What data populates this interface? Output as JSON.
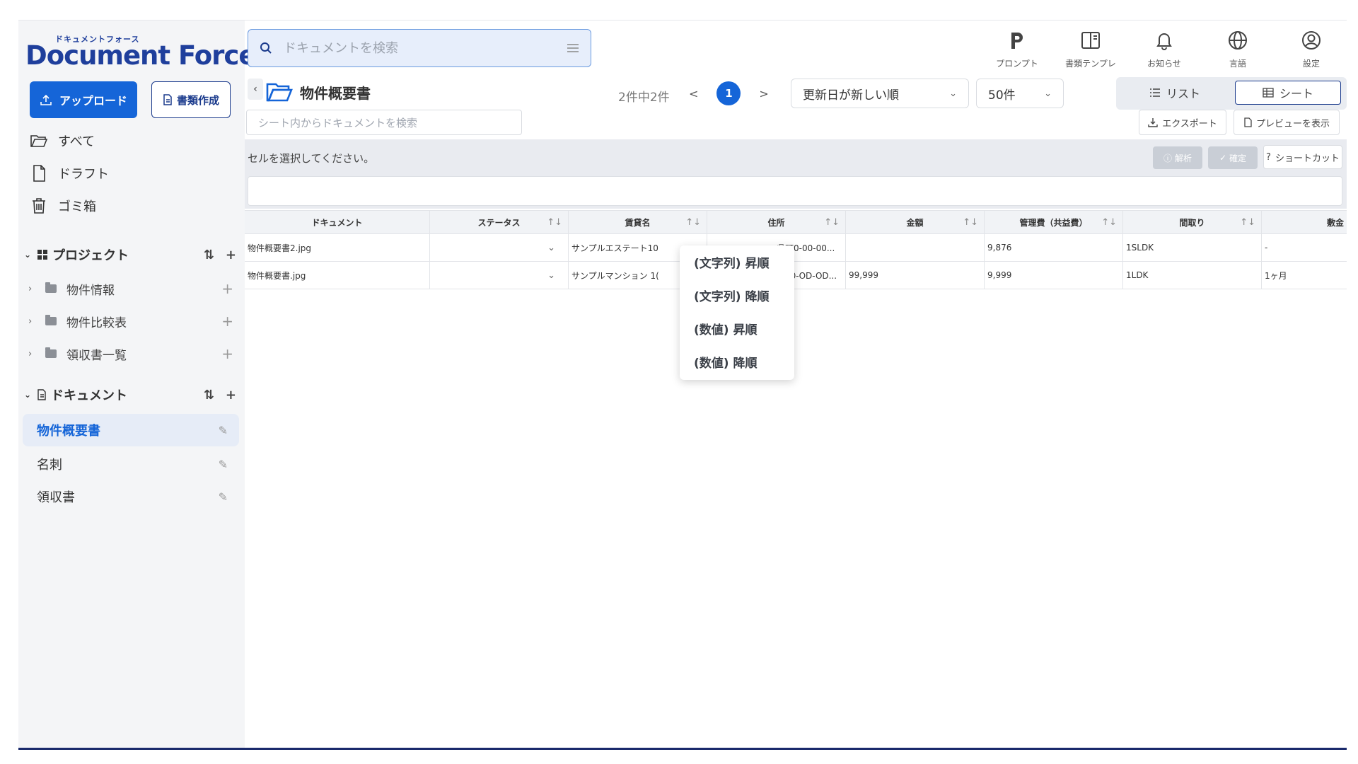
{
  "logo": {
    "small": "ドキュメントフォース",
    "big": "Document Force"
  },
  "sidebar": {
    "upload_label": "アップロード",
    "create_label": "書類作成",
    "nav": [
      {
        "label": "すべて",
        "icon": "folder-open-icon"
      },
      {
        "label": "ドラフト",
        "icon": "file-icon"
      },
      {
        "label": "ゴミ箱",
        "icon": "trash-icon"
      }
    ],
    "projects_title": "プロジェクト",
    "projects": [
      {
        "label": "物件情報"
      },
      {
        "label": "物件比較表"
      },
      {
        "label": "領収書一覧"
      }
    ],
    "documents_title": "ドキュメント",
    "documents": [
      {
        "label": "物件概要書",
        "active": true
      },
      {
        "label": "名刺",
        "active": false
      },
      {
        "label": "領収書",
        "active": false
      }
    ]
  },
  "header": {
    "search_placeholder": "ドキュメントを検索",
    "icons": [
      {
        "label": "プロンプト",
        "icon": "prompt-p-icon"
      },
      {
        "label": "書類テンプレ",
        "icon": "template-book-icon"
      },
      {
        "label": "お知らせ",
        "icon": "bell-icon"
      },
      {
        "label": "言語",
        "icon": "globe-icon"
      },
      {
        "label": "設定",
        "icon": "user-circle-icon"
      }
    ]
  },
  "toolbar": {
    "folder_title": "物件概要書",
    "count": "2件中2件",
    "page_prev": "<",
    "page_current": "1",
    "page_next": ">",
    "sort_value": "更新日が新しい順",
    "per_page_value": "50件",
    "view_list": "リスト",
    "view_sheet": "シート",
    "sheet_search_placeholder": "シート内からドキュメントを検索",
    "export_label": "エクスポート",
    "preview_label": "プレビューを表示",
    "cell_message": "セルを選択してください。",
    "analyze_label": "解析",
    "confirm_label": "確定",
    "shortcut_label": "ショートカット"
  },
  "table": {
    "columns": [
      "ドキュメント",
      "ステータス",
      "賃貸名",
      "住所",
      "金額",
      "管理費（共益費）",
      "間取り",
      "敷金"
    ],
    "rows": [
      [
        "物件概要書2.jpg",
        "",
        "サンプルエステート10",
        "県町0-00-00...",
        "",
        "9,876",
        "1SLDK",
        "-"
      ],
      [
        "物件概要書.jpg",
        "",
        "サンプルマンション 1(",
        "市00-OD-OD...",
        "99,999",
        "9,999",
        "1LDK",
        "1ヶ月"
      ]
    ]
  },
  "sort_menu": {
    "options": [
      "(文字列) 昇順",
      "(文字列) 降順",
      "(数値) 昇順",
      "(数値) 降順"
    ]
  },
  "colors": {
    "primary": "#1565d8",
    "navy": "#1a3a8c",
    "sidebar_bg": "#f4f5f7"
  }
}
